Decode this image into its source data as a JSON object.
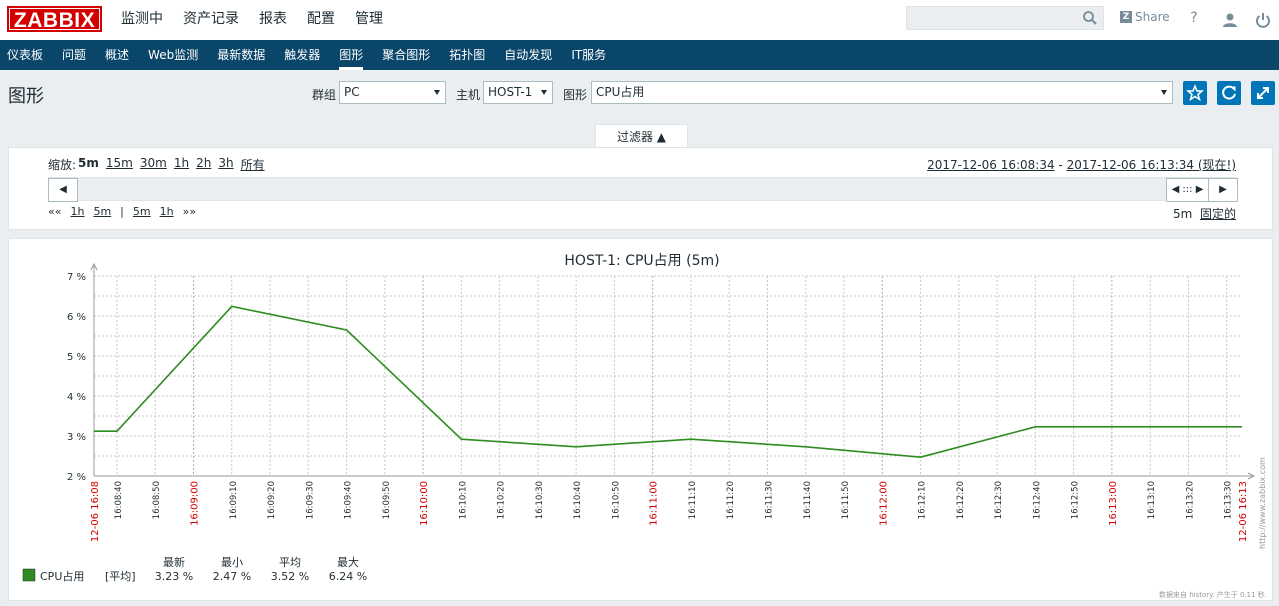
{
  "app": {
    "logo": "ZABBIX"
  },
  "main_menu": [
    {
      "label": "监测中",
      "active": true
    },
    {
      "label": "资产记录"
    },
    {
      "label": "报表"
    },
    {
      "label": "配置"
    },
    {
      "label": "管理"
    }
  ],
  "top_right": {
    "share_label": "Share",
    "help_icon": "question-icon",
    "user_icon": "user-icon",
    "power_icon": "power-icon"
  },
  "sub_menu": [
    {
      "label": "仪表板"
    },
    {
      "label": "问题"
    },
    {
      "label": "概述"
    },
    {
      "label": "Web监测"
    },
    {
      "label": "最新数据"
    },
    {
      "label": "触发器"
    },
    {
      "label": "图形",
      "active": true
    },
    {
      "label": "聚合图形"
    },
    {
      "label": "拓扑图"
    },
    {
      "label": "自动发现"
    },
    {
      "label": "IT服务"
    }
  ],
  "page": {
    "title": "图形"
  },
  "filters": {
    "group_label": "群组",
    "group_value": "PC",
    "host_label": "主机",
    "host_value": "HOST-1",
    "graph_label": "图形",
    "graph_value": "CPU占用"
  },
  "filter_tab": {
    "label": "过滤器 ▲"
  },
  "zoom": {
    "label": "缩放:",
    "options": [
      "5m",
      "15m",
      "30m",
      "1h",
      "2h",
      "3h",
      "所有"
    ],
    "current": "5m"
  },
  "period": {
    "from": "2017-12-06 16:08:34",
    "sep": " - ",
    "to": "2017-12-06 16:13:34 (现在!)"
  },
  "nav_left": {
    "back": "««",
    "a": "1h",
    "b": "5m",
    "sep": "|",
    "c": "5m",
    "d": "1h",
    "fwd": "»»"
  },
  "nav_right": {
    "period": "5m",
    "fixed": "固定的"
  },
  "graph": {
    "title": "HOST-1: CPU占用 (5m)",
    "y_ticks": [
      "7 %",
      "6 %",
      "5 %",
      "4 %",
      "3 %",
      "2 %"
    ],
    "x_labels": [
      {
        "t": "12-06 16:08",
        "red": true
      },
      {
        "t": "16:08:40"
      },
      {
        "t": "16:08:50"
      },
      {
        "t": "16:09:00",
        "red": true
      },
      {
        "t": "16:09:10"
      },
      {
        "t": "16:09:20"
      },
      {
        "t": "16:09:30"
      },
      {
        "t": "16:09:40"
      },
      {
        "t": "16:09:50"
      },
      {
        "t": "16:10:00",
        "red": true
      },
      {
        "t": "16:10:10"
      },
      {
        "t": "16:10:20"
      },
      {
        "t": "16:10:30"
      },
      {
        "t": "16:10:40"
      },
      {
        "t": "16:10:50"
      },
      {
        "t": "16:11:00",
        "red": true
      },
      {
        "t": "16:11:10"
      },
      {
        "t": "16:11:20"
      },
      {
        "t": "16:11:30"
      },
      {
        "t": "16:11:40"
      },
      {
        "t": "16:11:50"
      },
      {
        "t": "16:12:00",
        "red": true
      },
      {
        "t": "16:12:10"
      },
      {
        "t": "16:12:20"
      },
      {
        "t": "16:12:30"
      },
      {
        "t": "16:12:40"
      },
      {
        "t": "16:12:50"
      },
      {
        "t": "16:13:00",
        "red": true
      },
      {
        "t": "16:13:10"
      },
      {
        "t": "16:13:20"
      },
      {
        "t": "16:13:30"
      },
      {
        "t": "12-06 16:13",
        "red": true
      }
    ],
    "legend": {
      "name": "CPU占用",
      "func": "[平均]",
      "headers": [
        "最新",
        "最小",
        "平均",
        "最大"
      ],
      "values": [
        "3.23 %",
        "2.47 %",
        "3.52 %",
        "6.24 %"
      ],
      "color": "#2e8b20"
    },
    "watermark": "http://www.zabbix.com",
    "footer": "数据来自 history. 产生于 0.11 秒."
  },
  "chart_data": {
    "type": "line",
    "title": "HOST-1: CPU占用 (5m)",
    "ylim": [
      2,
      7
    ],
    "series": [
      {
        "name": "CPU占用",
        "x": [
          "16:08:34",
          "16:08:40",
          "16:09:10",
          "16:09:40",
          "16:10:10",
          "16:10:40",
          "16:11:10",
          "16:11:40",
          "16:12:10",
          "16:12:40",
          "16:13:34"
        ],
        "values": [
          3.12,
          3.12,
          6.24,
          5.65,
          2.92,
          2.73,
          2.92,
          2.73,
          2.47,
          3.23,
          3.23
        ]
      }
    ]
  }
}
